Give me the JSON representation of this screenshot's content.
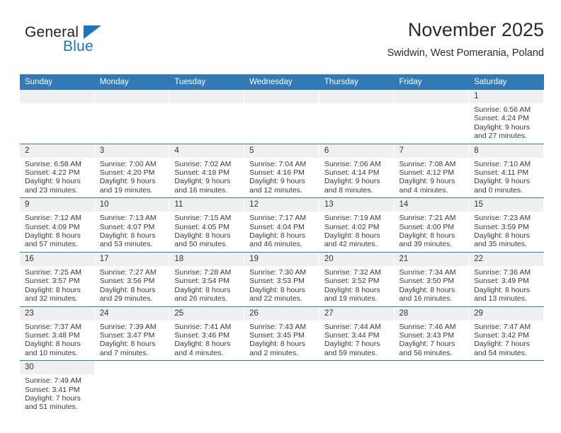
{
  "brand": {
    "name_part1": "General",
    "name_part2": "Blue",
    "accent_color": "#1b75bb"
  },
  "header": {
    "title": "November 2025",
    "subtitle": "Swidwin, West Pomerania, Poland"
  },
  "calendar": {
    "header_color": "#3279b7",
    "daynum_background": "#f0f0f0",
    "weekday_headers": [
      "Sunday",
      "Monday",
      "Tuesday",
      "Wednesday",
      "Thursday",
      "Friday",
      "Saturday"
    ],
    "labels": {
      "sunrise": "Sunrise:",
      "sunset": "Sunset:",
      "daylight": "Daylight:"
    },
    "weeks": [
      [
        {
          "day": "",
          "lines": []
        },
        {
          "day": "",
          "lines": []
        },
        {
          "day": "",
          "lines": []
        },
        {
          "day": "",
          "lines": []
        },
        {
          "day": "",
          "lines": []
        },
        {
          "day": "",
          "lines": []
        },
        {
          "day": "1",
          "lines": [
            "Sunrise: 6:56 AM",
            "Sunset: 4:24 PM",
            "Daylight: 9 hours",
            "and 27 minutes."
          ]
        }
      ],
      [
        {
          "day": "2",
          "lines": [
            "Sunrise: 6:58 AM",
            "Sunset: 4:22 PM",
            "Daylight: 9 hours",
            "and 23 minutes."
          ]
        },
        {
          "day": "3",
          "lines": [
            "Sunrise: 7:00 AM",
            "Sunset: 4:20 PM",
            "Daylight: 9 hours",
            "and 19 minutes."
          ]
        },
        {
          "day": "4",
          "lines": [
            "Sunrise: 7:02 AM",
            "Sunset: 4:18 PM",
            "Daylight: 9 hours",
            "and 16 minutes."
          ]
        },
        {
          "day": "5",
          "lines": [
            "Sunrise: 7:04 AM",
            "Sunset: 4:16 PM",
            "Daylight: 9 hours",
            "and 12 minutes."
          ]
        },
        {
          "day": "6",
          "lines": [
            "Sunrise: 7:06 AM",
            "Sunset: 4:14 PM",
            "Daylight: 9 hours",
            "and 8 minutes."
          ]
        },
        {
          "day": "7",
          "lines": [
            "Sunrise: 7:08 AM",
            "Sunset: 4:12 PM",
            "Daylight: 9 hours",
            "and 4 minutes."
          ]
        },
        {
          "day": "8",
          "lines": [
            "Sunrise: 7:10 AM",
            "Sunset: 4:11 PM",
            "Daylight: 9 hours",
            "and 0 minutes."
          ]
        }
      ],
      [
        {
          "day": "9",
          "lines": [
            "Sunrise: 7:12 AM",
            "Sunset: 4:09 PM",
            "Daylight: 8 hours",
            "and 57 minutes."
          ]
        },
        {
          "day": "10",
          "lines": [
            "Sunrise: 7:13 AM",
            "Sunset: 4:07 PM",
            "Daylight: 8 hours",
            "and 53 minutes."
          ]
        },
        {
          "day": "11",
          "lines": [
            "Sunrise: 7:15 AM",
            "Sunset: 4:05 PM",
            "Daylight: 8 hours",
            "and 50 minutes."
          ]
        },
        {
          "day": "12",
          "lines": [
            "Sunrise: 7:17 AM",
            "Sunset: 4:04 PM",
            "Daylight: 8 hours",
            "and 46 minutes."
          ]
        },
        {
          "day": "13",
          "lines": [
            "Sunrise: 7:19 AM",
            "Sunset: 4:02 PM",
            "Daylight: 8 hours",
            "and 42 minutes."
          ]
        },
        {
          "day": "14",
          "lines": [
            "Sunrise: 7:21 AM",
            "Sunset: 4:00 PM",
            "Daylight: 8 hours",
            "and 39 minutes."
          ]
        },
        {
          "day": "15",
          "lines": [
            "Sunrise: 7:23 AM",
            "Sunset: 3:59 PM",
            "Daylight: 8 hours",
            "and 35 minutes."
          ]
        }
      ],
      [
        {
          "day": "16",
          "lines": [
            "Sunrise: 7:25 AM",
            "Sunset: 3:57 PM",
            "Daylight: 8 hours",
            "and 32 minutes."
          ]
        },
        {
          "day": "17",
          "lines": [
            "Sunrise: 7:27 AM",
            "Sunset: 3:56 PM",
            "Daylight: 8 hours",
            "and 29 minutes."
          ]
        },
        {
          "day": "18",
          "lines": [
            "Sunrise: 7:28 AM",
            "Sunset: 3:54 PM",
            "Daylight: 8 hours",
            "and 26 minutes."
          ]
        },
        {
          "day": "19",
          "lines": [
            "Sunrise: 7:30 AM",
            "Sunset: 3:53 PM",
            "Daylight: 8 hours",
            "and 22 minutes."
          ]
        },
        {
          "day": "20",
          "lines": [
            "Sunrise: 7:32 AM",
            "Sunset: 3:52 PM",
            "Daylight: 8 hours",
            "and 19 minutes."
          ]
        },
        {
          "day": "21",
          "lines": [
            "Sunrise: 7:34 AM",
            "Sunset: 3:50 PM",
            "Daylight: 8 hours",
            "and 16 minutes."
          ]
        },
        {
          "day": "22",
          "lines": [
            "Sunrise: 7:36 AM",
            "Sunset: 3:49 PM",
            "Daylight: 8 hours",
            "and 13 minutes."
          ]
        }
      ],
      [
        {
          "day": "23",
          "lines": [
            "Sunrise: 7:37 AM",
            "Sunset: 3:48 PM",
            "Daylight: 8 hours",
            "and 10 minutes."
          ]
        },
        {
          "day": "24",
          "lines": [
            "Sunrise: 7:39 AM",
            "Sunset: 3:47 PM",
            "Daylight: 8 hours",
            "and 7 minutes."
          ]
        },
        {
          "day": "25",
          "lines": [
            "Sunrise: 7:41 AM",
            "Sunset: 3:46 PM",
            "Daylight: 8 hours",
            "and 4 minutes."
          ]
        },
        {
          "day": "26",
          "lines": [
            "Sunrise: 7:43 AM",
            "Sunset: 3:45 PM",
            "Daylight: 8 hours",
            "and 2 minutes."
          ]
        },
        {
          "day": "27",
          "lines": [
            "Sunrise: 7:44 AM",
            "Sunset: 3:44 PM",
            "Daylight: 7 hours",
            "and 59 minutes."
          ]
        },
        {
          "day": "28",
          "lines": [
            "Sunrise: 7:46 AM",
            "Sunset: 3:43 PM",
            "Daylight: 7 hours",
            "and 56 minutes."
          ]
        },
        {
          "day": "29",
          "lines": [
            "Sunrise: 7:47 AM",
            "Sunset: 3:42 PM",
            "Daylight: 7 hours",
            "and 54 minutes."
          ]
        }
      ],
      [
        {
          "day": "30",
          "lines": [
            "Sunrise: 7:49 AM",
            "Sunset: 3:41 PM",
            "Daylight: 7 hours",
            "and 51 minutes."
          ]
        },
        {
          "day": "",
          "lines": []
        },
        {
          "day": "",
          "lines": []
        },
        {
          "day": "",
          "lines": []
        },
        {
          "day": "",
          "lines": []
        },
        {
          "day": "",
          "lines": []
        },
        {
          "day": "",
          "lines": []
        }
      ]
    ]
  }
}
